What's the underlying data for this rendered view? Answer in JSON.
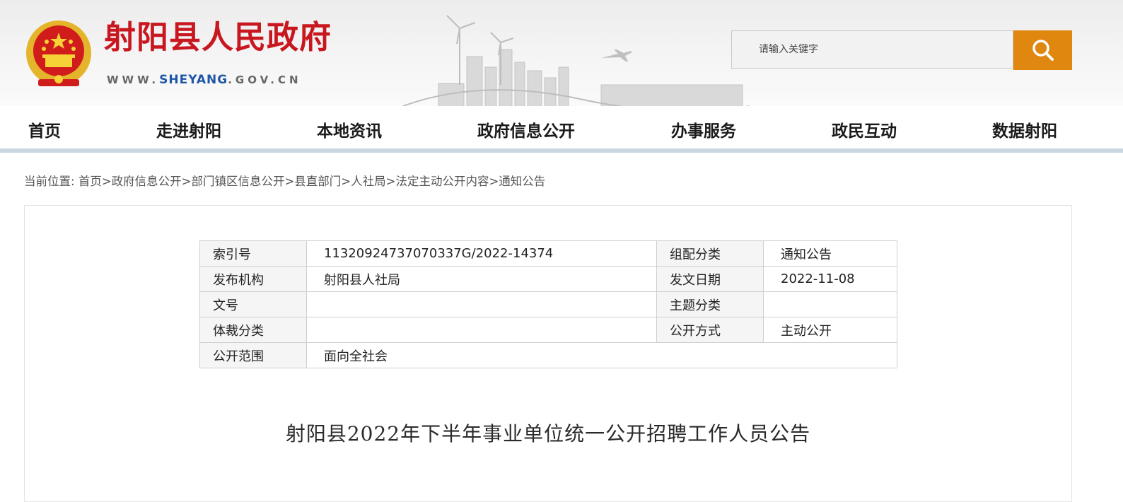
{
  "header": {
    "site_name": "射阳县人民政府",
    "url_prefix": "WWW.",
    "url_highlight": "SHEYANG",
    "url_suffix": ".GOV.CN",
    "search": {
      "placeholder": "请输入关键字"
    }
  },
  "nav": {
    "items": [
      {
        "label": "首页"
      },
      {
        "label": "走进射阳"
      },
      {
        "label": "本地资讯"
      },
      {
        "label": "政府信息公开"
      },
      {
        "label": "办事服务"
      },
      {
        "label": "政民互动"
      },
      {
        "label": "数据射阳"
      }
    ]
  },
  "breadcrumb": {
    "prefix": "当前位置:",
    "items": [
      "首页",
      "政府信息公开",
      "部门镇区信息公开",
      "县直部门",
      "人社局",
      "法定主动公开内容",
      "通知公告"
    ]
  },
  "meta_table": {
    "index_label": "索引号",
    "index_value": "1132092473707033 7G/2022-14374",
    "category_label": "组配分类",
    "category_value": "通知公告",
    "publisher_label": "发布机构",
    "publisher_value": "射阳县人社局",
    "date_label": "发文日期",
    "date_value": "2022-11-08",
    "docno_label": "文号",
    "docno_value": "",
    "topic_label": "主题分类",
    "topic_value": "",
    "genre_label": "体裁分类",
    "genre_value": "",
    "mode_label": "公开方式",
    "mode_value": "主动公开",
    "scope_label": "公开范围",
    "scope_value": "面向全社会"
  },
  "document": {
    "title": "射阳县2022年下半年事业单位统一公开招聘工作人员公告"
  },
  "colors": {
    "brand_red": "#c8171e",
    "url_blue": "#1f57a8",
    "search_orange": "#e0870f",
    "nav_underline": "#cbd6e3"
  }
}
